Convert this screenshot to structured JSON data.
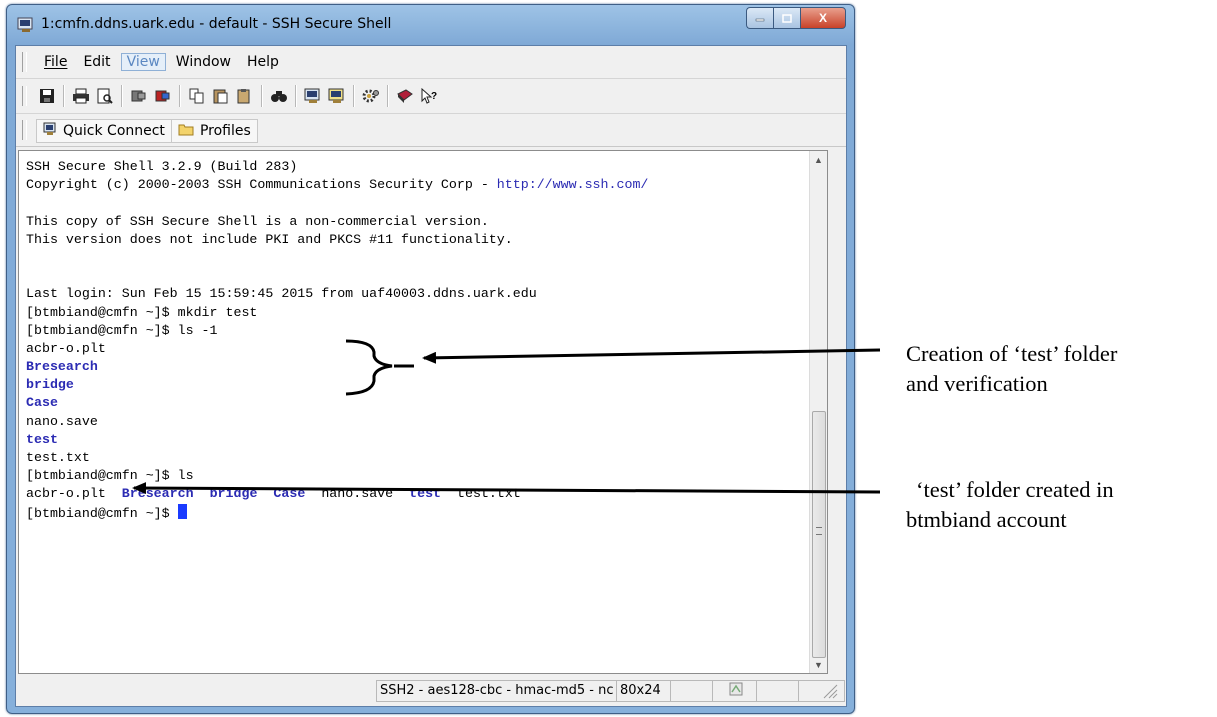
{
  "window": {
    "title": "1:cmfn.ddns.uark.edu - default - SSH Secure Shell",
    "caption_buttons": {
      "minimize": "–",
      "maximize": "▫",
      "close": "X"
    }
  },
  "menu": [
    "File",
    "Edit",
    "View",
    "Window",
    "Help"
  ],
  "toolbar_icons": [
    "save-icon",
    "print-icon",
    "print-preview-icon",
    "disconnect-icon",
    "connect-icon",
    "copy-icon",
    "paste-icon",
    "paste-selection-icon",
    "find-icon",
    "new-terminal-icon",
    "new-file-transfer-icon",
    "settings-icon",
    "help-book-icon",
    "context-help-icon"
  ],
  "linkbar": {
    "quick_connect": "Quick Connect",
    "profiles": "Profiles"
  },
  "terminal": {
    "lines": [
      {
        "text": "SSH Secure Shell 3.2.9 (Build 283)"
      },
      {
        "text": "Copyright (c) 2000-2003 SSH Communications Security Corp - ",
        "link": "http://www.ssh.com/"
      },
      {
        "text": ""
      },
      {
        "text": "This copy of SSH Secure Shell is a non-commercial version."
      },
      {
        "text": "This version does not include PKI and PKCS #11 functionality."
      },
      {
        "text": ""
      },
      {
        "text": ""
      },
      {
        "text": "Last login: Sun Feb 15 15:59:45 2015 from uaf40003.ddns.uark.edu"
      },
      {
        "text": "[btmbiand@cmfn ~]$ mkdir test"
      },
      {
        "text": "[btmbiand@cmfn ~]$ ls -1"
      },
      {
        "text": "acbr-o.plt"
      },
      {
        "text": "Bresearch",
        "dir": true
      },
      {
        "text": "bridge",
        "dir": true
      },
      {
        "text": "Case",
        "dir": true
      },
      {
        "text": "nano.save"
      },
      {
        "text": "test",
        "dir": true
      },
      {
        "text": "test.txt"
      },
      {
        "text": "[btmbiand@cmfn ~]$ ls"
      }
    ],
    "ls_row": [
      {
        "text": "acbr-o.plt",
        "dir": false
      },
      {
        "text": "Bresearch",
        "dir": true
      },
      {
        "text": "bridge",
        "dir": true
      },
      {
        "text": "Case",
        "dir": true
      },
      {
        "text": "nano.save",
        "dir": false
      },
      {
        "text": "test",
        "dir": true
      },
      {
        "text": "test.txt",
        "dir": false
      }
    ],
    "prompt": "[btmbiand@cmfn ~]$ "
  },
  "statusbar": {
    "cipher": "SSH2 - aes128-cbc - hmac-md5 - nc",
    "size": "80x24"
  },
  "annotations": {
    "top": [
      "Creation of ‘test’ folder",
      "and verification"
    ],
    "bottom": [
      "‘test’ folder created in",
      "btmbiand account"
    ]
  }
}
